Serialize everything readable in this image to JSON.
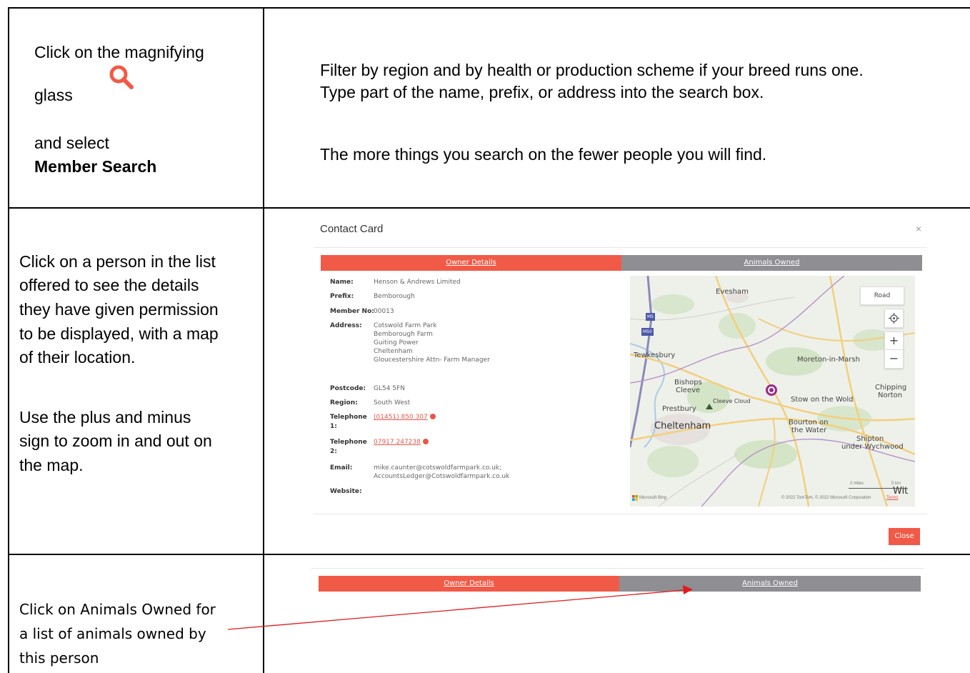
{
  "row1": {
    "left": {
      "line1": "Click on the magnifying",
      "line2": "glass",
      "line3": "and select",
      "line4": "Member Search"
    },
    "right": {
      "line1": "Filter by region and by health or production scheme if your breed runs one.",
      "line2": "Type part of the name, prefix, or address into the search box.",
      "line3": "The more things you search on the fewer people you will find."
    }
  },
  "row2": {
    "left": {
      "line1": "Click on a person in the list",
      "line2": "offered to see the details",
      "line3": "they have given permission",
      "line4": "to be displayed, with a map",
      "line5": "of their location.",
      "line6": "Use the plus and minus",
      "line7": "sign to zoom in and out on",
      "line8": "the map."
    },
    "card": {
      "title": "Contact Card",
      "close_x": "×",
      "tab_owner": "Owner Details",
      "tab_animals": "Animals Owned",
      "labels": {
        "name": "Name:",
        "prefix": "Prefix:",
        "member_no": "Member No:",
        "address": "Address:",
        "postcode": "Postcode:",
        "region": "Region:",
        "tel1a": "Telephone",
        "tel1b": "1:",
        "tel2a": "Telephone",
        "tel2b": "2:",
        "email": "Email:",
        "website": "Website:"
      },
      "values": {
        "name": "Henson & Andrews Limited",
        "prefix": "Bemborough",
        "member_no": "00013",
        "address1": "Cotswold Farm Park",
        "address2": "Bemborough Farm",
        "address3": "Guiting Power",
        "address4": "Cheltenham",
        "address5": "Gloucestershire Attn- Farm Manager",
        "postcode": "GL54 5FN",
        "region": "South West",
        "tel1": "(01451) 850 307",
        "tel2": "07917 247238",
        "email1": "mike.caunter@cotswoldfarmpark.co.uk;",
        "email2": "AccountsLedger@Cotswoldfarmpark.co.uk"
      },
      "map": {
        "road_button": "Road",
        "zoom_in": "+",
        "zoom_out": "−",
        "locate_icon": "crosshair-icon",
        "places": {
          "evesham": "Evesham",
          "tewkesbury": "Tewkesbury",
          "moreton": "Moreton-in-Marsh",
          "bishops1": "Bishops",
          "bishops2": "Cleeve",
          "chipping1": "Chipping",
          "chipping2": "Norton",
          "cleeve_cloud": "Cleeve Cloud",
          "stow": "Stow on the Wold",
          "prestbury": "Prestbury",
          "cheltenham": "Cheltenham",
          "bourton1": "Bourton on",
          "bourton2": "the Water",
          "shipton1": "Shipton",
          "shipton2": "under Wychwood",
          "wit": "Wit",
          "m5a": "M5",
          "m50": "M50"
        },
        "scale_miles": "2 miles",
        "scale_km": "5 km",
        "brand": "Microsoft Bing",
        "copyright": "© 2022 TomTom, © 2022 Microsoft Corporation",
        "terms": "Terms"
      },
      "close_button": "Close"
    }
  },
  "row3": {
    "left": {
      "line1": "Click on Animals Owned for",
      "line2": "a list of animals  owned by",
      "line3": "this person"
    },
    "tab_owner": "Owner Details",
    "tab_animals": "Animals Owned"
  },
  "colors": {
    "accent_red": "#f15a47",
    "tab_grey": "#8e8e93",
    "arrow": "#e01b1b"
  }
}
